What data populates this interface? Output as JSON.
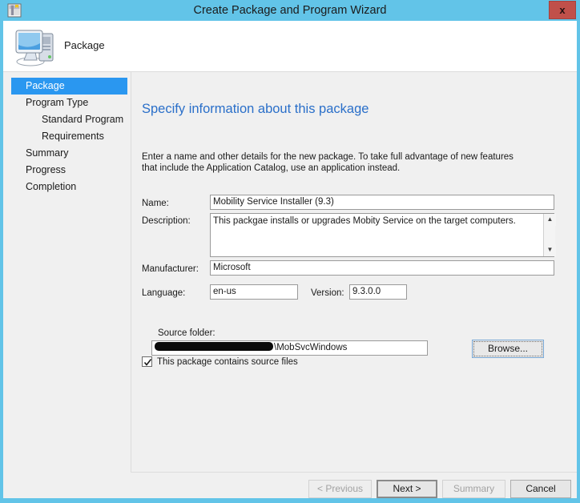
{
  "window": {
    "title": "Create Package and Program Wizard",
    "title_icon": "package-wizard-icon",
    "close_label": "x",
    "accent_color": "#62c4e8"
  },
  "header": {
    "title": "Package",
    "icon": "computer-monitor-icon"
  },
  "sidebar": {
    "items": [
      {
        "label": "Package",
        "selected": true,
        "sub": false
      },
      {
        "label": "Program Type",
        "selected": false,
        "sub": false
      },
      {
        "label": "Standard Program",
        "selected": false,
        "sub": true
      },
      {
        "label": "Requirements",
        "selected": false,
        "sub": true
      },
      {
        "label": "Summary",
        "selected": false,
        "sub": false
      },
      {
        "label": "Progress",
        "selected": false,
        "sub": false
      },
      {
        "label": "Completion",
        "selected": false,
        "sub": false
      }
    ],
    "selected_color": "#2a97f0"
  },
  "main": {
    "heading": "Specify information about this package",
    "heading_color": "#2a6fc9",
    "intro": "Enter a name and other details for the new package. To take full advantage of new features that include the Application Catalog, use an application instead.",
    "fields": {
      "name_label": "Name:",
      "name_value": "Mobility Service Installer (9.3)",
      "description_label": "Description:",
      "description_value": "This packgae installs or upgrades Mobity Service on the target computers.",
      "manufacturer_label": "Manufacturer:",
      "manufacturer_value": "Microsoft",
      "language_label": "Language:",
      "language_value": "en-us",
      "version_label": "Version:",
      "version_value": "9.3.0.0"
    },
    "source_checkbox": {
      "label": "This package contains source files",
      "checked": true
    },
    "source_folder": {
      "label": "Source folder:",
      "value_visible": "\\MobSvcWindows",
      "redacted": true,
      "browse_label": "Browse..."
    }
  },
  "footer": {
    "buttons": [
      {
        "label": "< Previous",
        "state": "disabled"
      },
      {
        "label": "Next >",
        "state": "default"
      },
      {
        "label": "Summary",
        "state": "disabled"
      },
      {
        "label": "Cancel",
        "state": "normal"
      }
    ]
  }
}
